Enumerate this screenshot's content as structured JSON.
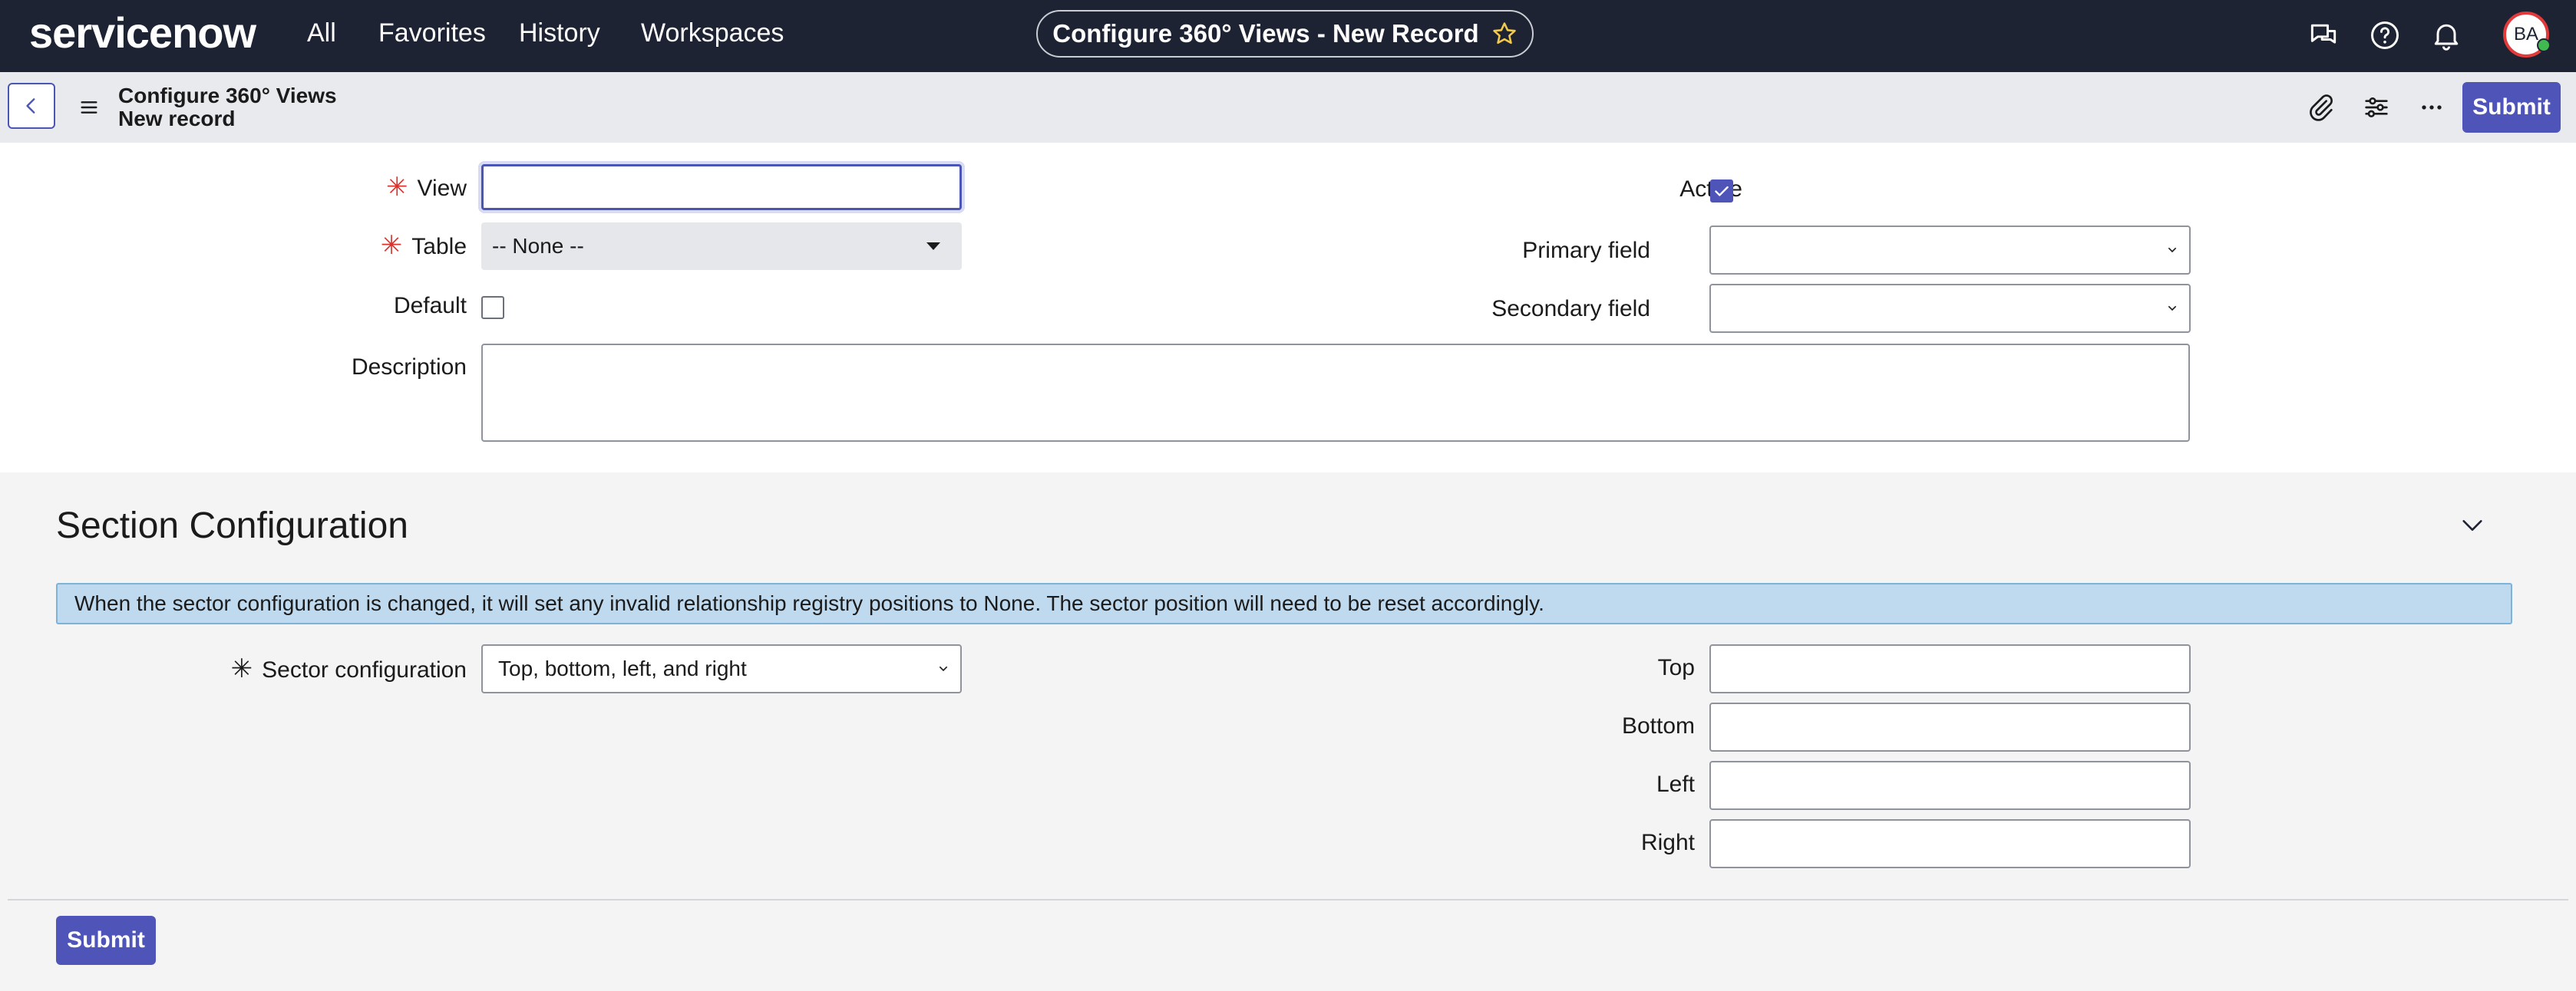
{
  "topnav": {
    "logo": "servicenow",
    "items": [
      "All",
      "Favorites",
      "History",
      "Workspaces"
    ],
    "record_title": "Configure 360° Views - New Record",
    "avatar_initials": "BA"
  },
  "subbar": {
    "title_line1": "Configure 360° Views",
    "title_line2": "New record",
    "submit_label": "Submit"
  },
  "form": {
    "view_label": "View",
    "view_value": "",
    "table_label": "Table",
    "table_value": "-- None --",
    "default_label": "Default",
    "default_checked": false,
    "description_label": "Description",
    "description_value": "",
    "active_label": "Active",
    "active_checked": true,
    "primary_field_label": "Primary field",
    "primary_field_value": "",
    "secondary_field_label": "Secondary field",
    "secondary_field_value": ""
  },
  "section": {
    "title": "Section Configuration",
    "info_message": "When the sector configuration is changed, it will set any invalid relationship registry positions to None. The sector position will need to be reset accordingly.",
    "sector_config_label": "Sector configuration",
    "sector_config_value": "Top, bottom, left, and right",
    "top_label": "Top",
    "bottom_label": "Bottom",
    "left_label": "Left",
    "right_label": "Right",
    "top_value": "",
    "bottom_value": "",
    "left_value": "",
    "right_value": "",
    "submit_label": "Submit"
  },
  "colors": {
    "nav_bg": "#1d2333",
    "accent": "#4e54b8",
    "required": "#d8342f",
    "info_bg": "#bfd9ee"
  }
}
